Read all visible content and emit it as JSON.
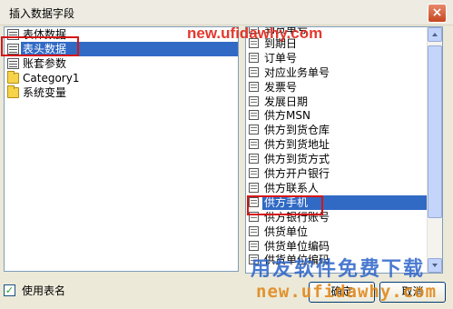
{
  "window": {
    "title": "插入数据字段",
    "close_label": "×"
  },
  "left_list": {
    "items": [
      {
        "label": "表体数据",
        "icon": "table-icon",
        "selected": false
      },
      {
        "label": "表头数据",
        "icon": "table-icon",
        "selected": true
      },
      {
        "label": "账套参数",
        "icon": "table-icon",
        "selected": false
      },
      {
        "label": "Category1",
        "icon": "folder-icon",
        "selected": false
      },
      {
        "label": "系统变量",
        "icon": "folder-icon",
        "selected": false
      }
    ]
  },
  "right_list": {
    "items": [
      {
        "label": "到货单号",
        "selected": false
      },
      {
        "label": "到期日",
        "selected": false
      },
      {
        "label": "订单号",
        "selected": false
      },
      {
        "label": "对应业务单号",
        "selected": false
      },
      {
        "label": "发票号",
        "selected": false
      },
      {
        "label": "发展日期",
        "selected": false
      },
      {
        "label": "供方MSN",
        "selected": false
      },
      {
        "label": "供方到货仓库",
        "selected": false
      },
      {
        "label": "供方到货地址",
        "selected": false
      },
      {
        "label": "供方到货方式",
        "selected": false
      },
      {
        "label": "供方开户银行",
        "selected": false
      },
      {
        "label": "供方联系人",
        "selected": false
      },
      {
        "label": "供方手机",
        "selected": true
      },
      {
        "label": "供方银行账号",
        "selected": false
      },
      {
        "label": "供货单位",
        "selected": false
      },
      {
        "label": "供货单位编码",
        "selected": false
      },
      {
        "label": "供货单位编码",
        "selected": false
      }
    ]
  },
  "footer": {
    "checkbox_label": "使用表名",
    "checkbox_checked": true,
    "ok_label": "确定",
    "cancel_label": "取消"
  },
  "watermarks": {
    "top": "new.ufidawhy.com",
    "bottom_brand": "用友软件免费下载",
    "bottom_url": "new.ufidawhy.com"
  },
  "colors": {
    "selection": "#316ac5",
    "annotation_box": "#d41616"
  }
}
